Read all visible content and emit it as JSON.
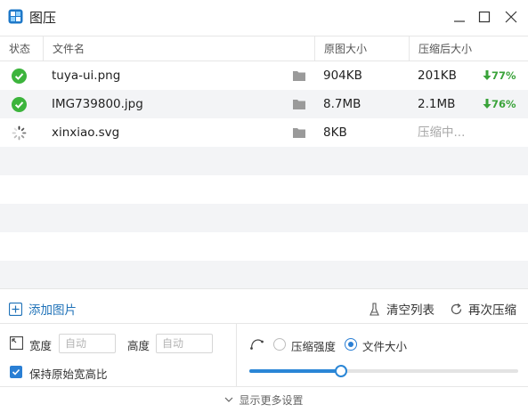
{
  "app": {
    "title": "图压"
  },
  "table": {
    "columns": {
      "status": "状态",
      "filename": "文件名",
      "original_size": "原图大小",
      "compressed_size": "压缩后大小"
    },
    "rows": [
      {
        "status": "done",
        "filename": "tuya-ui.png",
        "original": "904KB",
        "compressed": "201KB",
        "saving": "77%"
      },
      {
        "status": "done",
        "filename": "IMG739800.jpg",
        "original": "8.7MB",
        "compressed": "2.1MB",
        "saving": "76%"
      },
      {
        "status": "processing",
        "filename": "xinxiao.svg",
        "original": "8KB",
        "compressed": "压缩中...",
        "saving": ""
      }
    ]
  },
  "toolbar": {
    "add_label": "添加图片",
    "clear_label": "清空列表",
    "recompress_label": "再次压缩"
  },
  "settings": {
    "width_label": "宽度",
    "width_placeholder": "自动",
    "height_label": "高度",
    "height_placeholder": "自动",
    "keep_ratio_label": "保持原始宽高比",
    "keep_ratio_checked": true,
    "mode_strength_label": "压缩强度",
    "mode_size_label": "文件大小",
    "selected_mode": "文件大小",
    "slider_value": 0.34
  },
  "footer": {
    "more_label": "显示更多设置"
  },
  "colors": {
    "accent": "#2a7fd4",
    "success": "#3aa33a",
    "stripe": "#f3f4f6"
  }
}
